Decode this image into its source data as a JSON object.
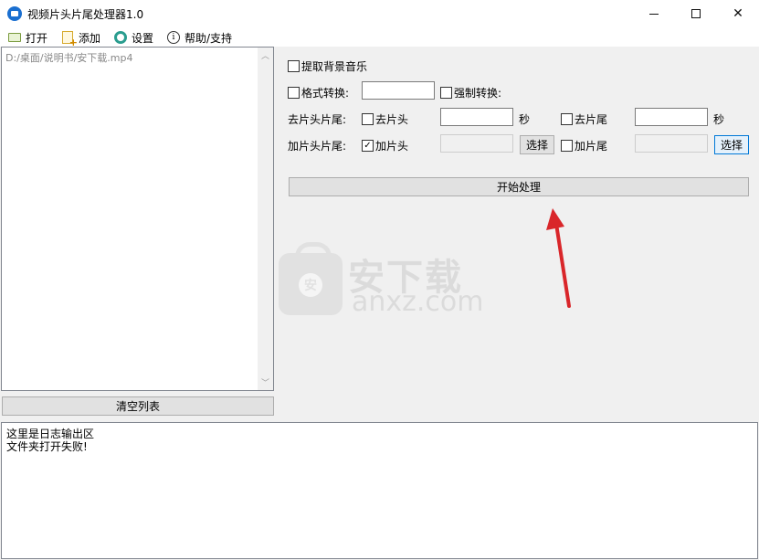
{
  "window": {
    "title": "视频片头片尾处理器1.0"
  },
  "menu": {
    "items": [
      {
        "label": "打开",
        "icon": "folder-open-icon"
      },
      {
        "label": "添加",
        "icon": "add-file-icon"
      },
      {
        "label": "设置",
        "icon": "gear-icon"
      },
      {
        "label": "帮助/支持",
        "icon": "info-icon"
      }
    ]
  },
  "file_list": {
    "items": [
      "D:/桌面/说明书/安下载.mp4"
    ],
    "clear_button": "清空列表"
  },
  "options": {
    "extract_bgm": {
      "label": "提取背景音乐",
      "checked": false
    },
    "format_convert": {
      "label": "格式转换:",
      "checked": false,
      "value": ""
    },
    "force_convert": {
      "label": "强制转换:",
      "checked": false
    },
    "remove_row": {
      "label": "去片头片尾:",
      "remove_head": {
        "label": "去片头",
        "checked": false,
        "value": "",
        "unit": "秒"
      },
      "remove_tail": {
        "label": "去片尾",
        "checked": false,
        "value": "",
        "unit": "秒"
      }
    },
    "add_row": {
      "label": "加片头片尾:",
      "add_head": {
        "label": "加片头",
        "checked": true,
        "value": "",
        "button": "选择"
      },
      "add_tail": {
        "label": "加片尾",
        "checked": false,
        "value": "",
        "button": "选择"
      }
    },
    "start_button": "开始处理"
  },
  "watermark": {
    "title": "安下载",
    "subtitle": "anxz.com",
    "badge": "安"
  },
  "log": {
    "lines": [
      "这里是日志输出区",
      "文件夹打开失败!"
    ]
  },
  "colors": {
    "accent": "#0078d7",
    "arrow": "#d9262a"
  }
}
